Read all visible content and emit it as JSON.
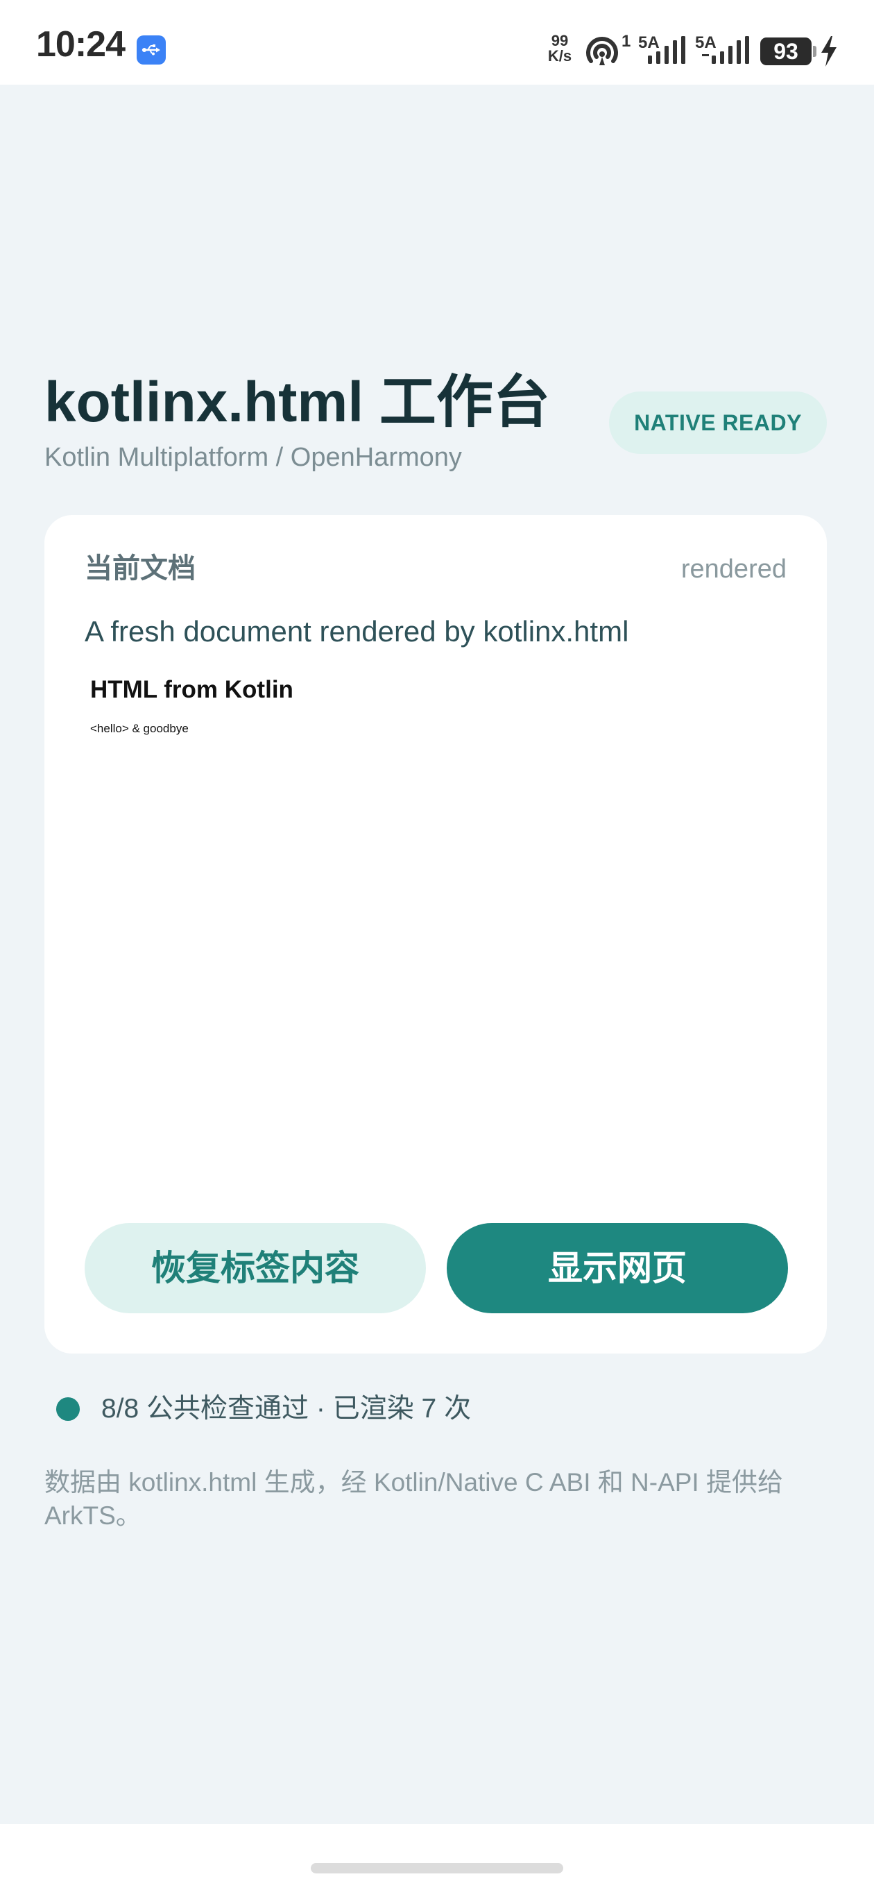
{
  "status_bar": {
    "time": "10:24",
    "net_speed_value": "99",
    "net_speed_unit": "K/s",
    "hotspot_count": "1",
    "sim1_label": "5A",
    "sim2_label": "5A",
    "battery": "93"
  },
  "header": {
    "title": "kotlinx.html 工作台",
    "subtitle": "Kotlin Multiplatform / OpenHarmony",
    "status_pill": "NATIVE READY"
  },
  "document": {
    "label": "当前文档",
    "state": "rendered",
    "summary": "A fresh document rendered by kotlinx.html",
    "preview": {
      "heading": "HTML from Kotlin",
      "body": "<hello> & goodbye"
    }
  },
  "actions": {
    "restore_label": "恢复标签内容",
    "show_label": "显示网页"
  },
  "checks": {
    "text": "8/8 公共检查通过 · 已渲染 7 次",
    "dot_color": "#1e8880"
  },
  "footnote": "数据由 kotlinx.html 生成，经 Kotlin/Native C ABI 和 N-API 提供给 ArkTS。",
  "colors": {
    "accent": "#1e8880",
    "accent_soft": "#def2ef",
    "background": "#eff4f7",
    "usb_badge": "#3b82f6"
  },
  "icons": {
    "usb": "usb-icon",
    "hotspot": "hotspot-icon",
    "signal": "signal-icon",
    "charge": "charging-bolt-icon"
  }
}
